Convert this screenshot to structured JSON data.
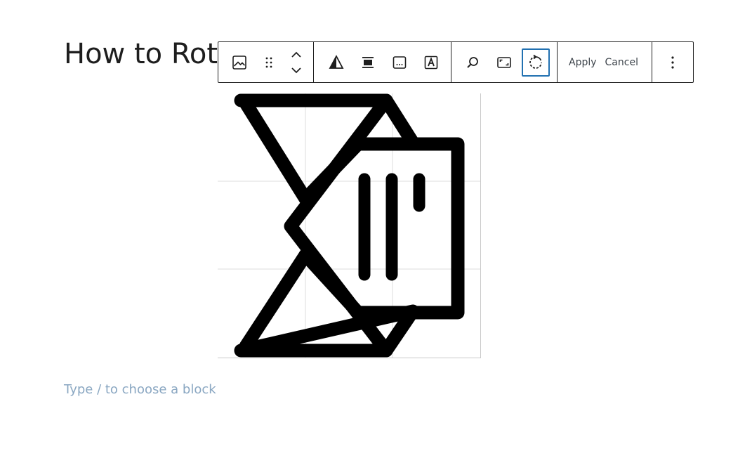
{
  "post": {
    "title": "How to Rotate an Image in WordPress",
    "placeholder": "Type / to choose a block"
  },
  "toolbar": {
    "buttons": [
      {
        "name": "image-block-icon",
        "active": false
      },
      {
        "name": "drag-handle-icon",
        "active": false
      },
      {
        "name": "move-up-down-icon",
        "active": false
      },
      {
        "name": "duotone-icon",
        "active": false
      },
      {
        "name": "align-icon",
        "active": false
      },
      {
        "name": "caption-icon",
        "active": false
      },
      {
        "name": "text-over-image-icon",
        "active": false
      },
      {
        "name": "zoom-icon",
        "active": false
      },
      {
        "name": "aspect-ratio-icon",
        "active": false
      },
      {
        "name": "rotate-icon",
        "active": true
      }
    ],
    "apply_label": "Apply",
    "cancel_label": "Cancel",
    "more_options_icon": "more-vertical-icon"
  },
  "image": {
    "icon": "envelope-with-letter-icon"
  },
  "colors": {
    "accent": "#2271b1",
    "placeholder": "#8aa7c2",
    "text": "#1e1e1e"
  }
}
